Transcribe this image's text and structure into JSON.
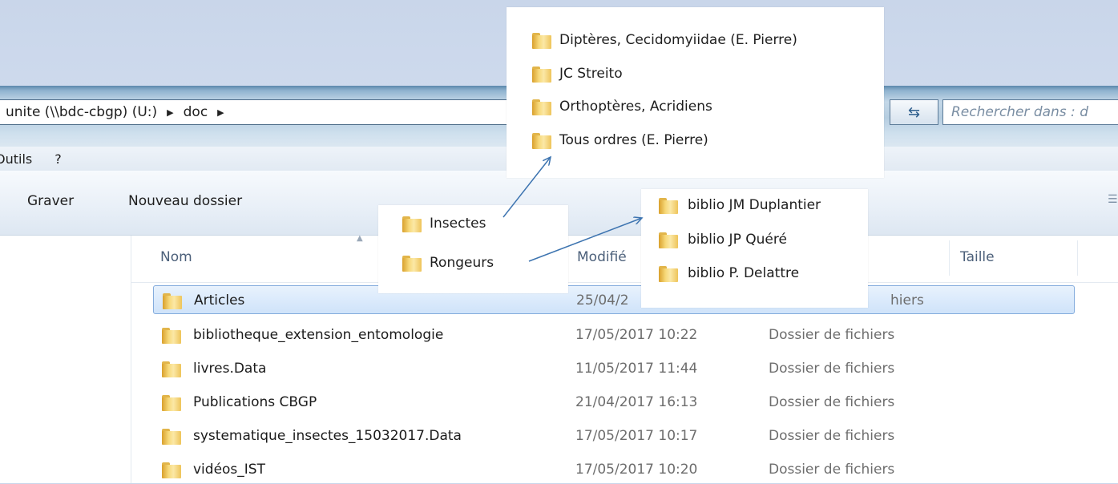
{
  "address": {
    "segments": [
      "unite (\\\\bdc-cbgp) (U:)",
      "doc"
    ],
    "search_placeholder": "Rechercher dans : d"
  },
  "menu": {
    "items": [
      "Outils",
      "?"
    ]
  },
  "toolbar": {
    "burn_label": "Graver",
    "new_folder_label": "Nouveau dossier"
  },
  "columns": {
    "name": "Nom",
    "modified": "Modifié",
    "size": "Taille"
  },
  "files": [
    {
      "name": "Articles",
      "date": "25/04/2",
      "type": "hiers",
      "selected": true
    },
    {
      "name": "bibliotheque_extension_entomologie",
      "date": "17/05/2017 10:22",
      "type": "Dossier de fichiers"
    },
    {
      "name": "livres.Data",
      "date": "11/05/2017 11:44",
      "type": "Dossier de fichiers"
    },
    {
      "name": "Publications CBGP",
      "date": "21/04/2017 16:13",
      "type": "Dossier de fichiers"
    },
    {
      "name": "systematique_insectes_15032017.Data",
      "date": "17/05/2017 10:17",
      "type": "Dossier de fichiers"
    },
    {
      "name": "vidéos_IST",
      "date": "17/05/2017 10:20",
      "type": "Dossier de fichiers"
    }
  ],
  "articles_subfolders": [
    "Insectes",
    "Rongeurs"
  ],
  "insectes_subfolders": [
    "Diptères, Cecidomyiidae (E. Pierre)",
    "JC Streito",
    "Orthoptères, Acridiens",
    "Tous ordres (E. Pierre)"
  ],
  "rongeurs_subfolders": [
    "biblio JM Duplantier",
    "biblio JP Quéré",
    "biblio P. Delattre"
  ],
  "colors": {
    "arrow": "#3d74b0",
    "selection_border": "#84acdd",
    "folder": "#f2c94c"
  }
}
